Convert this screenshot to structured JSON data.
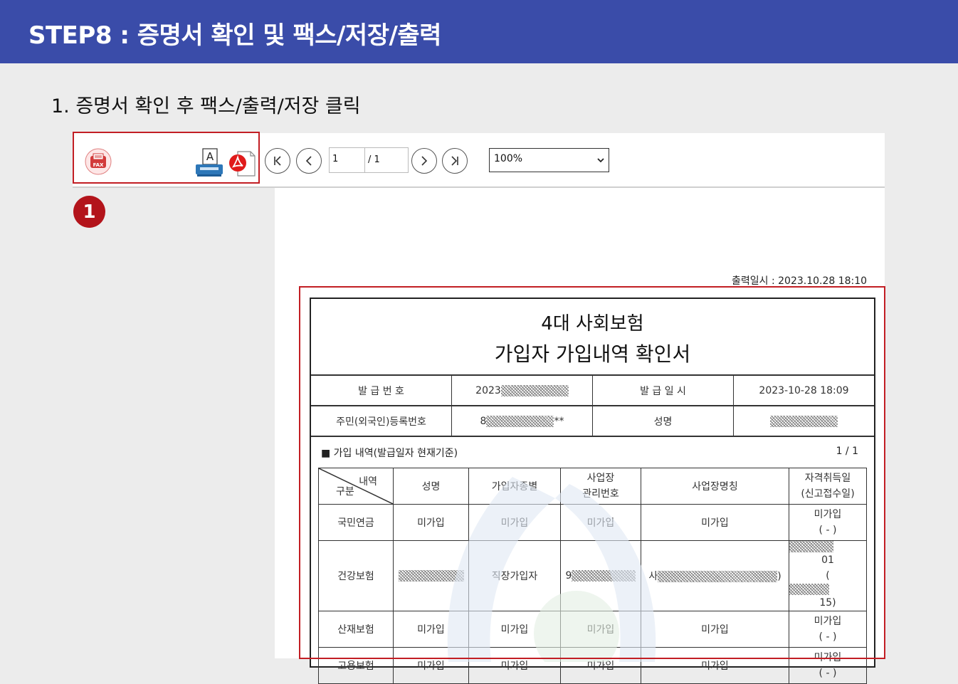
{
  "header": {
    "title": "STEP8 : 증명서 확인 및 팩스/저장/출력"
  },
  "instruction": "1. 증명서 확인 후 팩스/출력/저장 클릭",
  "toolbar": {
    "fax_label": "FAX",
    "print_label": "A",
    "page_current": "1",
    "page_total": "/ 1",
    "zoom": "100%"
  },
  "badge": "1",
  "colors": {
    "header_bg": "#3a4ca9",
    "highlight": "#c21e24",
    "badge": "#b3141b"
  },
  "document": {
    "print_time": "출력일시 : 2023.10.28 18:10",
    "title_line1": "4대 사회보험",
    "title_line2": "가입자 가입내역 확인서",
    "issue_no_label": "발 급 번 호",
    "issue_no_value": "2023",
    "issue_date_label": "발 급 일 시",
    "issue_date_value": "2023-10-28 18:09",
    "resident_no_label": "주민(외국인)등록번호",
    "resident_no_prefix": "8",
    "resident_no_suffix": "**",
    "name_label": "성명",
    "section_label": "■ 가입 내역(발급일자 현재기준)",
    "page_indicator": "1   /   1",
    "headers": {
      "diag_top": "내역",
      "diag_bottom": "구분",
      "name": "성명",
      "type": "가입자종별",
      "biz_no_1": "사업장",
      "biz_no_2": "관리번호",
      "biz_name": "사업장명칭",
      "date_1": "자격취득일",
      "date_2": "(신고접수일)"
    },
    "rows": [
      {
        "category": "국민연금",
        "name": "미가입",
        "type": "미가입",
        "biz_no": "미가입",
        "biz_name": "미가입",
        "date": "미가입",
        "date_sub": "( - )"
      },
      {
        "category": "건강보험",
        "type": "직장가입자",
        "biz_no_prefix": "9",
        "biz_name_prefix": "사",
        "biz_name_suffix": ")",
        "date": "01",
        "date_sub_prefix": "(",
        "date_sub": "15)"
      },
      {
        "category": "산재보험",
        "name": "미가입",
        "type": "미가입",
        "biz_no": "미가입",
        "biz_name": "미가입",
        "date": "미가입",
        "date_sub": "( - )"
      },
      {
        "category": "고용보험",
        "name": "미가입",
        "type": "미가입",
        "biz_no": "미가입",
        "biz_name": "미가입",
        "date": "미가입",
        "date_sub": "( - )"
      }
    ]
  }
}
